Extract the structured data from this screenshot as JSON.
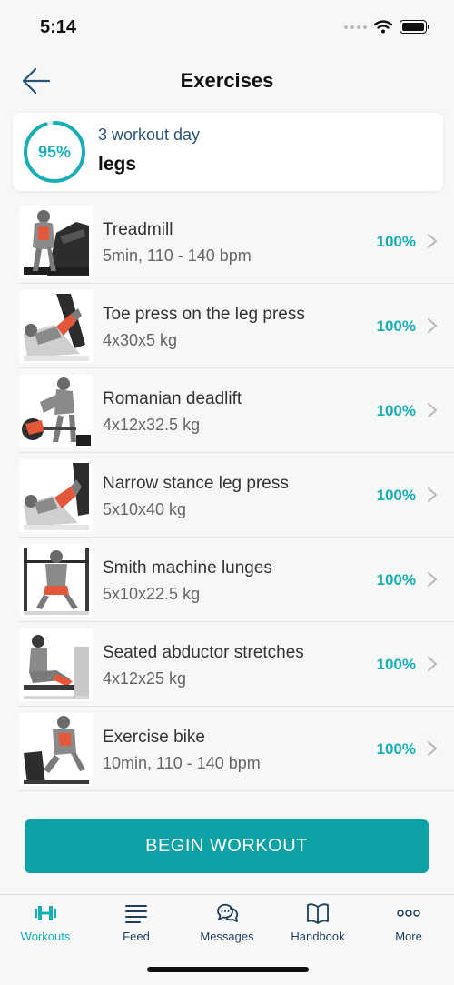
{
  "status_bar": {
    "time": "5:14"
  },
  "header": {
    "title": "Exercises"
  },
  "summary": {
    "progress_label": "95%",
    "progress_fraction": 0.95,
    "subtitle": "3 workout day",
    "title": "legs"
  },
  "exercises": [
    {
      "name": "Treadmill",
      "detail": "5min, 110 - 140 bpm",
      "percent": "100%"
    },
    {
      "name": "Toe press on the leg press",
      "detail": "4x30x5 kg",
      "percent": "100%"
    },
    {
      "name": "Romanian deadlift",
      "detail": "4x12x32.5 kg",
      "percent": "100%"
    },
    {
      "name": "Narrow stance leg press",
      "detail": "5x10x40 kg",
      "percent": "100%"
    },
    {
      "name": "Smith machine lunges",
      "detail": "5x10x22.5 kg",
      "percent": "100%"
    },
    {
      "name": "Seated abductor stretches",
      "detail": "4x12x25 kg",
      "percent": "100%"
    },
    {
      "name": "Exercise bike",
      "detail": "10min, 110 - 140 bpm",
      "percent": "100%"
    }
  ],
  "actions": {
    "begin_label": "BEGIN WORKOUT"
  },
  "tabs": [
    {
      "label": "Workouts",
      "icon": "dumbbell-icon",
      "active": true
    },
    {
      "label": "Feed",
      "icon": "list-icon",
      "active": false
    },
    {
      "label": "Messages",
      "icon": "chat-bubbles-icon",
      "active": false
    },
    {
      "label": "Handbook",
      "icon": "book-icon",
      "active": false
    },
    {
      "label": "More",
      "icon": "more-dots-icon",
      "active": false
    }
  ],
  "colors": {
    "accent": "#17aeb5",
    "button": "#0da2a6",
    "muscle": "#e3573b"
  }
}
